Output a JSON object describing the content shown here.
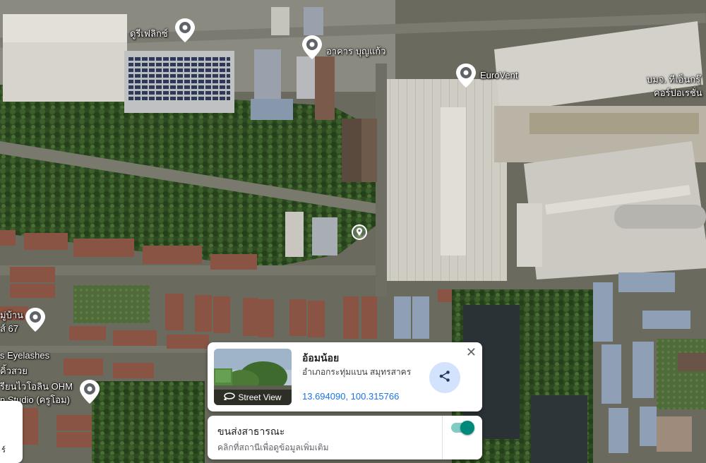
{
  "map": {
    "view": "satellite",
    "colors": {
      "forest": "#2f4a22",
      "road": "#6f6f66",
      "roof_light": "#cfcdc6",
      "roof_red": "#8a4a3a",
      "pin": "#5f6368"
    },
    "labels": [
      {
        "id": "durifelix",
        "text": "ดูรีเฟลิกซ์"
      },
      {
        "id": "boonkaew",
        "text": "อาคาร บุญแก้ว"
      },
      {
        "id": "eurovent",
        "text": "EuroVent"
      },
      {
        "id": "corp",
        "text": "บมจ. ทีเอ็นกรุ๊"
      },
      {
        "id": "corp2",
        "text": "คอร์ปอเรชั่น"
      },
      {
        "id": "village",
        "text": "มู่บ้าน"
      },
      {
        "id": "village2",
        "text": "ส์ 67"
      },
      {
        "id": "eyelashes",
        "text": "s Eyelashes"
      },
      {
        "id": "eyelashes2",
        "text": "คิ้วสวย"
      },
      {
        "id": "violin",
        "text": "รียนไวโอลิน OHM"
      },
      {
        "id": "violin2",
        "text": "n Studio (ครูโอม)"
      }
    ],
    "pin_icon": "map-pin-icon",
    "dropped_pin_icon": "dropped-pin-icon"
  },
  "place_card": {
    "name": "อ้อมน้อย",
    "address": "อำเภอกระทุ่มแบน สมุทรสาคร",
    "coordinates": "13.694090, 100.315766",
    "street_view_label": "Street View",
    "close_icon": "close-icon",
    "share_icon": "share-icon",
    "rotate_icon": "rotate-360-icon"
  },
  "transit_card": {
    "title": "ขนส่งสาธารณะ",
    "subtitle": "คลิกที่สถานีเพื่อดูข้อมูลเพิ่มเติม",
    "toggle_on": true,
    "accent": "#00897b"
  },
  "layer_thumb": {
    "label": "ร์"
  }
}
